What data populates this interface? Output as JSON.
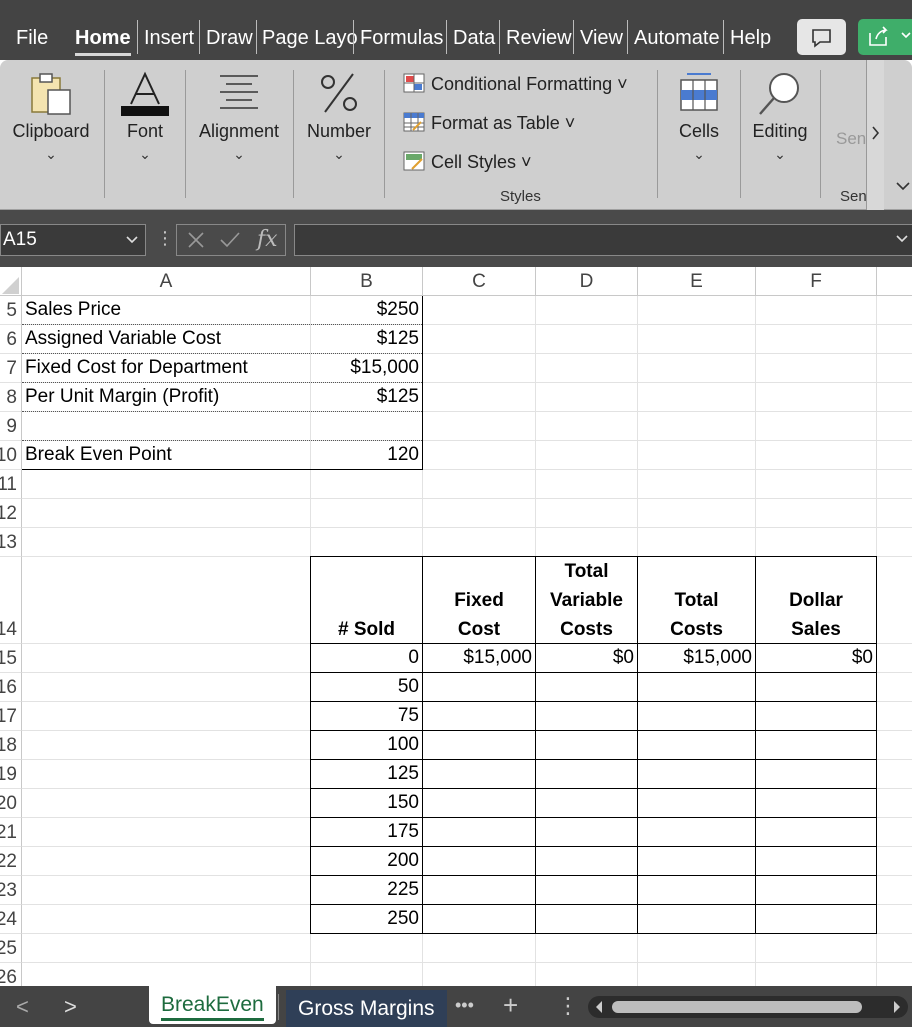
{
  "menu": {
    "tabs": [
      "File",
      "Home",
      "Insert",
      "Draw",
      "Page Layo",
      "Formulas",
      "Data",
      "Review",
      "View",
      "Automate",
      "Help"
    ],
    "active": "Home"
  },
  "ribbon": {
    "clipboard": "Clipboard",
    "font": "Font",
    "alignment": "Alignment",
    "number": "Number",
    "conditional_formatting": "Conditional Formatting",
    "format_as_table": "Format as Table",
    "cell_styles": "Cell Styles",
    "styles_group": "Styles",
    "cells": "Cells",
    "editing": "Editing",
    "sensitivity_button": "Sen",
    "sensitivity_group": "Sen",
    "chevron": "⌄",
    "dropdown_caret": "˅",
    "icons": {
      "clipboard": "clipboard-icon",
      "font": "font-color-icon",
      "alignment": "align-icon",
      "number": "percent-icon",
      "cells": "cells-icon",
      "editing": "search-icon"
    }
  },
  "formula_bar": {
    "name_box": "A15",
    "fx": "fx",
    "formula": ""
  },
  "columns": [
    "A",
    "B",
    "C",
    "D",
    "E",
    "F"
  ],
  "rows": [
    "5",
    "6",
    "7",
    "8",
    "9",
    "10",
    "11",
    "12",
    "13",
    "14",
    "15",
    "16",
    "17",
    "18",
    "19",
    "20",
    "21",
    "22",
    "23",
    "24",
    "25",
    "26"
  ],
  "assumptions": {
    "sales_price_label": "Sales Price",
    "sales_price": "$250",
    "variable_cost_label": "Assigned Variable Cost",
    "variable_cost": "$125",
    "fixed_cost_label": "Fixed Cost for Department",
    "fixed_cost": "$15,000",
    "margin_label": "Per Unit Margin (Profit)",
    "margin": "$125",
    "break_even_label": "Break Even Point",
    "break_even": "120"
  },
  "table": {
    "headers": {
      "sold": "# Sold",
      "fixed_1": "Fixed",
      "fixed_2": "Cost",
      "variable_1": "Total",
      "variable_2": "Variable",
      "variable_3": "Costs",
      "total_1": "Total",
      "total_2": "Costs",
      "dollar_1": "Dollar",
      "dollar_2": "Sales"
    },
    "first_row": {
      "sold": "0",
      "fixed_cost": "$15,000",
      "variable_costs": "$0",
      "total_costs": "$15,000",
      "dollar_sales": "$0"
    },
    "sold_values": [
      "50",
      "75",
      "100",
      "125",
      "150",
      "175",
      "200",
      "225",
      "250"
    ]
  },
  "sheets": {
    "active": "BreakEven",
    "other": "Gross Margins",
    "more": "•••",
    "add": "+",
    "menu": "⋮",
    "prev": "<",
    "next": ">"
  }
}
